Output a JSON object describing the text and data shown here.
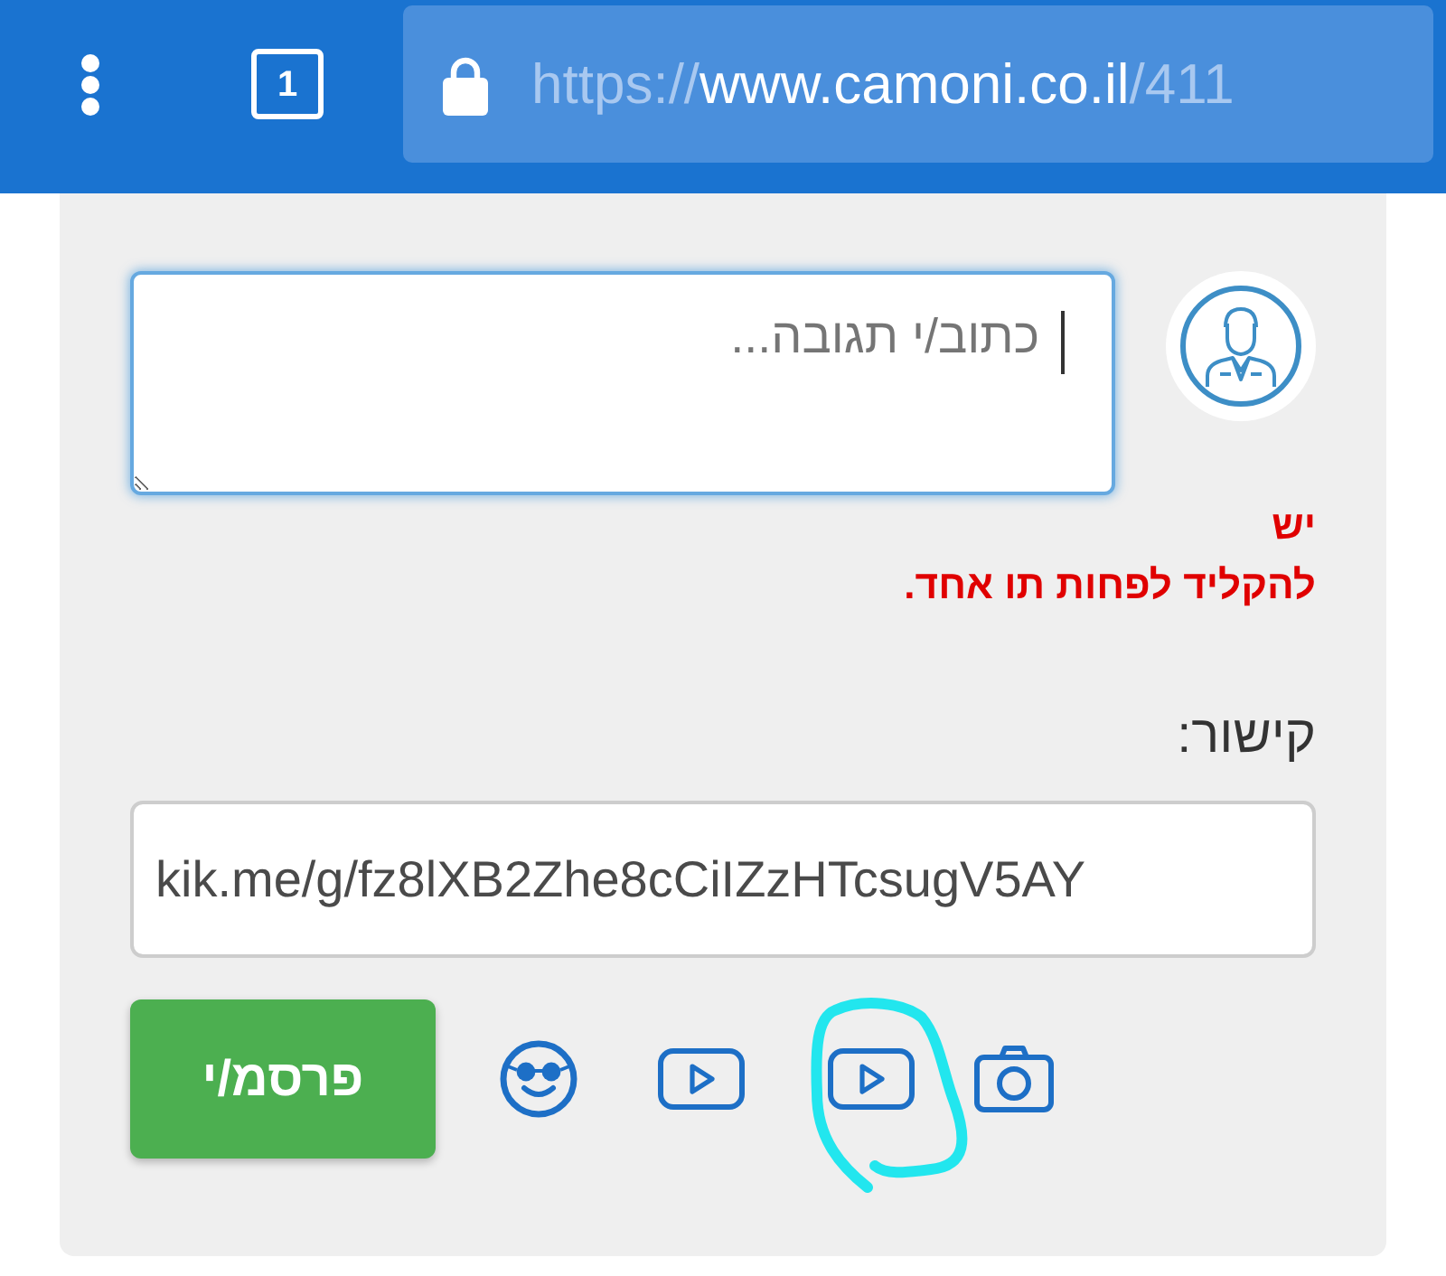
{
  "browser": {
    "tab_count": "1",
    "url": {
      "scheme": "https://",
      "host": "www.camoni.co.il",
      "path": "/411"
    }
  },
  "comment_form": {
    "reply": {
      "placeholder": "כתוב/י תגובה...",
      "focused": true
    },
    "error": "יש להקליד לפחות תו אחד.",
    "link": {
      "label": "קישור:",
      "value": "kik.me/g/fz8lXB2Zhe8cCiIZzHTcsugV5AY"
    },
    "submit": "פרסמ/י"
  }
}
